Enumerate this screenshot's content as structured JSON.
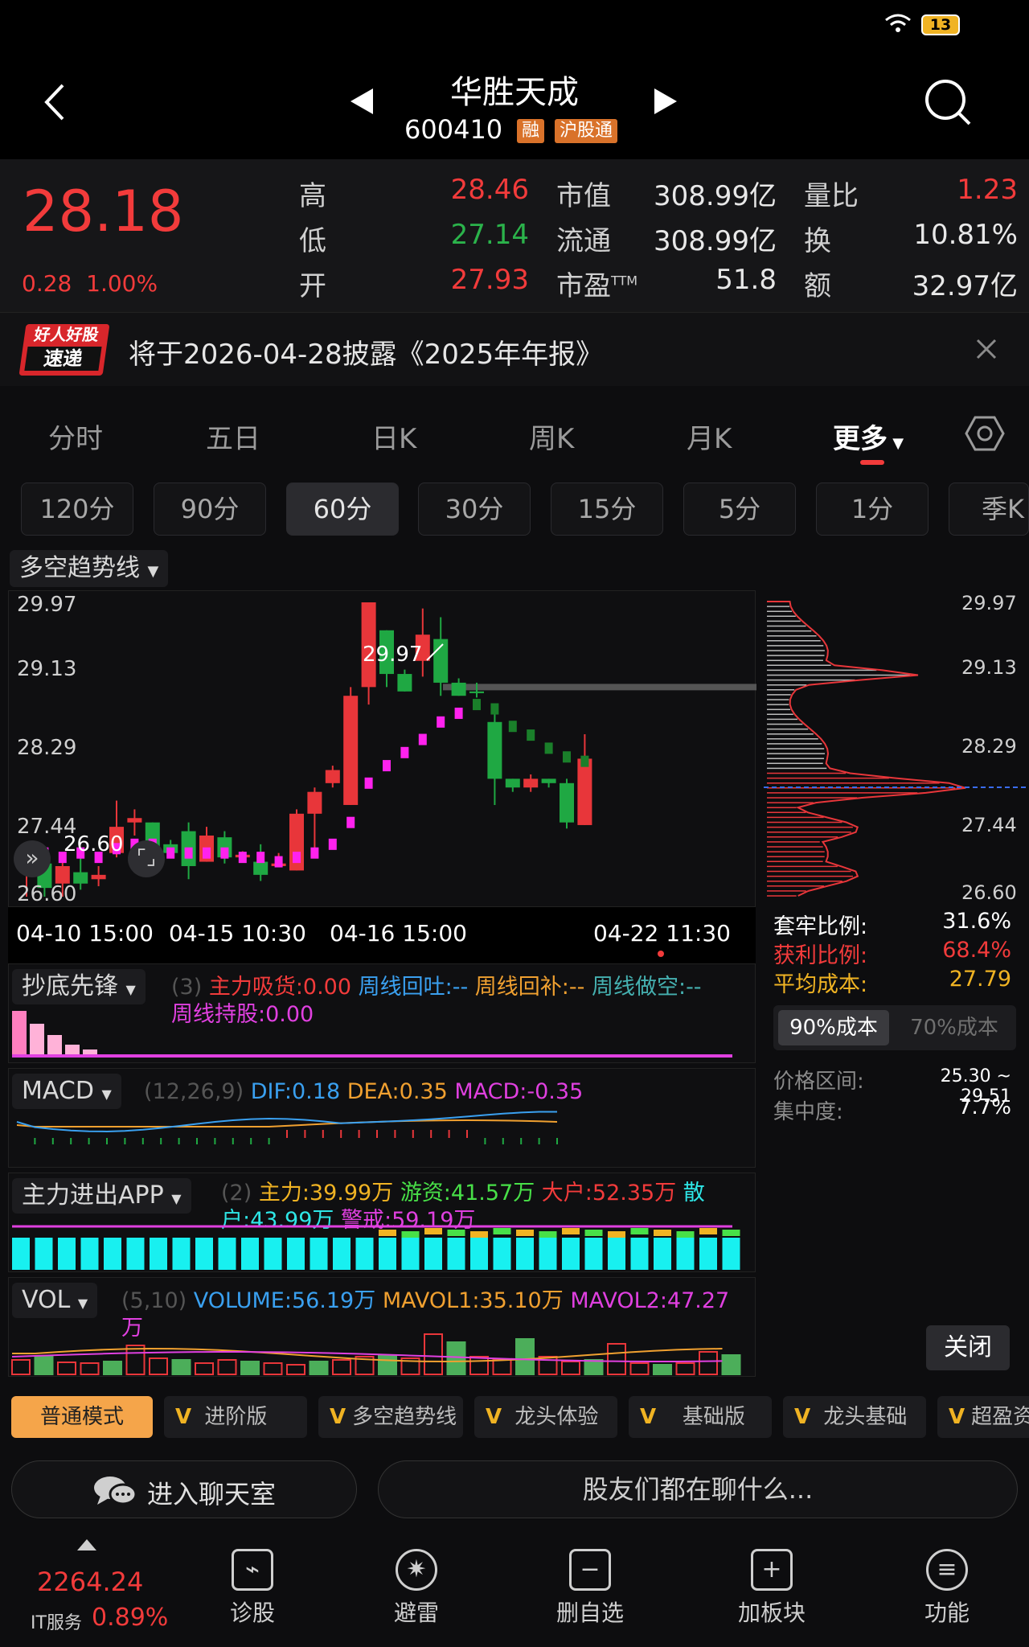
{
  "status": {
    "battery": "13"
  },
  "header": {
    "title": "华胜天成",
    "code": "600410",
    "tag1": "融",
    "tag2": "沪股通"
  },
  "quote": {
    "price": "28.18",
    "change": "0.28",
    "change_pct": "1.00%",
    "rows": [
      {
        "l1": "高",
        "v1": "28.46",
        "l2": "市值",
        "v2": "308.99亿",
        "l3": "量比",
        "v3": "1.23"
      },
      {
        "l1": "低",
        "v1": "27.14",
        "l2": "流通",
        "v2": "308.99亿",
        "l3": "换",
        "v3": "10.81%"
      },
      {
        "l1": "开",
        "v1": "27.93",
        "l2": "市盈",
        "l2sup": "TTM",
        "v2": "51.8",
        "l3": "额",
        "v3": "32.97亿"
      }
    ]
  },
  "notice": {
    "badge_top": "好人好股",
    "badge_bottom": "速递",
    "text": "将于2026-04-28披露《2025年年报》"
  },
  "tabs": [
    {
      "label": "分时"
    },
    {
      "label": "五日"
    },
    {
      "label": "日K"
    },
    {
      "label": "周K"
    },
    {
      "label": "月K"
    },
    {
      "label": "更多"
    }
  ],
  "ktypes": [
    {
      "label": "120分"
    },
    {
      "label": "90分"
    },
    {
      "label": "60分"
    },
    {
      "label": "30分"
    },
    {
      "label": "15分"
    },
    {
      "label": "5分"
    },
    {
      "label": "1分"
    },
    {
      "label": "季K"
    }
  ],
  "main_chart": {
    "indicator": "多空趋势线",
    "price_labels": [
      "29.97",
      "29.13",
      "28.29",
      "27.44",
      "26.60"
    ],
    "high_marker": "29.97",
    "low_marker": "26.60",
    "dates": [
      "04-10 15:00",
      "04-15 10:30",
      "04-16 15:00",
      "04-22 11:30"
    ]
  },
  "chart_data": {
    "type": "candlestick",
    "ylim": [
      26.6,
      29.97
    ],
    "candles": [
      [
        26.9,
        26.9,
        26.6,
        26.9
      ],
      [
        26.98,
        26.7,
        26.6,
        27.0
      ],
      [
        26.75,
        26.95,
        26.6,
        27.0
      ],
      [
        26.88,
        26.75,
        26.68,
        27.1
      ],
      [
        26.8,
        26.85,
        26.72,
        26.95
      ],
      [
        27.1,
        27.4,
        27.05,
        27.7
      ],
      [
        27.45,
        27.5,
        27.3,
        27.6
      ],
      [
        27.45,
        27.0,
        26.9,
        27.45
      ],
      [
        27.2,
        27.1,
        27.05,
        27.25
      ],
      [
        27.35,
        26.95,
        26.8,
        27.45
      ],
      [
        27.0,
        27.3,
        27.0,
        27.4
      ],
      [
        27.28,
        27.05,
        26.98,
        27.35
      ],
      [
        27.05,
        27.08,
        27.0,
        27.12
      ],
      [
        27.0,
        26.85,
        26.78,
        27.2
      ],
      [
        26.95,
        26.98,
        26.95,
        27.1
      ],
      [
        26.9,
        27.55,
        26.9,
        27.6
      ],
      [
        27.55,
        27.8,
        27.1,
        27.85
      ],
      [
        27.9,
        28.05,
        27.85,
        28.1
      ],
      [
        27.65,
        28.9,
        27.65,
        29.0
      ],
      [
        29.0,
        29.97,
        28.8,
        29.97
      ],
      [
        29.65,
        29.15,
        29.0,
        29.65
      ],
      [
        29.15,
        28.95,
        28.95,
        29.2
      ],
      [
        29.3,
        29.6,
        29.12,
        29.9
      ],
      [
        29.55,
        29.05,
        28.9,
        29.8
      ],
      [
        29.05,
        28.9,
        28.9,
        29.1
      ],
      [
        28.95,
        28.93,
        28.88,
        29.05
      ],
      [
        28.6,
        27.95,
        27.65,
        28.75
      ],
      [
        27.95,
        27.85,
        27.8,
        27.95
      ],
      [
        27.85,
        27.95,
        27.8,
        28.0
      ],
      [
        27.95,
        27.9,
        27.85,
        27.95
      ],
      [
        27.9,
        27.45,
        27.38,
        27.95
      ],
      [
        27.42,
        28.18,
        27.42,
        28.46
      ]
    ],
    "trend": [
      27.1,
      27.1,
      27.05,
      27.1,
      27.05,
      27.15,
      27.2,
      27.2,
      27.1,
      27.1,
      27.1,
      27.1,
      27.05,
      27.05,
      27.0,
      27.05,
      27.1,
      27.2,
      27.45,
      27.9,
      28.1,
      28.25,
      28.4,
      28.6,
      28.7,
      28.8,
      28.75,
      28.55,
      28.45,
      28.3,
      28.2,
      28.15
    ],
    "resistance": 29.0
  },
  "chip": {
    "labels": [
      "29.97",
      "29.13",
      "28.29",
      "27.44",
      "26.60"
    ],
    "rows": [
      {
        "label": "套牢比例:",
        "value": "31.6%"
      },
      {
        "label": "获利比例:",
        "value": "68.4%"
      },
      {
        "label": "平均成本:",
        "value": "27.79"
      }
    ],
    "btn1": "90%成本",
    "btn2": "70%成本",
    "range_label": "价格区间:",
    "range": "25.30 ~ 29.51",
    "conc_label": "集中度:",
    "conc": "7.7%",
    "close": "关闭"
  },
  "ind1": {
    "name": "抄底先锋",
    "param": "(3)",
    "items": [
      {
        "t": "主力吸货:0.00",
        "c": "#f23b3b"
      },
      {
        "t": "周线回吐:--",
        "c": "#3aa0f0"
      },
      {
        "t": "周线回补:--",
        "c": "#f0a030"
      },
      {
        "t": "周线做空:--",
        "c": "#45b0b0"
      },
      {
        "t": "周线持股:0.00",
        "c": "#e040e0"
      }
    ]
  },
  "ind2": {
    "name": "MACD",
    "param": "(12,26,9)",
    "items": [
      {
        "t": "DIF:0.18",
        "c": "#3aa0f0"
      },
      {
        "t": "DEA:0.35",
        "c": "#f0a030"
      },
      {
        "t": "MACD:-0.35",
        "c": "#e040e0"
      }
    ]
  },
  "ind3": {
    "name": "主力进出APP",
    "param": "(2)",
    "items": [
      {
        "t": "主力:39.99万",
        "c": "#f0b323"
      },
      {
        "t": "游资:41.57万",
        "c": "#48e048"
      },
      {
        "t": "大户:52.35万",
        "c": "#f23b3b"
      },
      {
        "t": "散户:43.99万",
        "c": "#2ee6e6"
      },
      {
        "t": "警戒:59.19万",
        "c": "#e040e0"
      }
    ]
  },
  "ind4": {
    "name": "VOL",
    "param": "(5,10)",
    "items": [
      {
        "t": "VOLUME:56.19万",
        "c": "#3aa0f0"
      },
      {
        "t": "MAVOL1:35.10万",
        "c": "#f0a030"
      },
      {
        "t": "MAVOL2:47.27万",
        "c": "#e040e0"
      }
    ]
  },
  "modes": [
    {
      "label": "普通模式"
    },
    {
      "label": "进阶版"
    },
    {
      "label": "多空趋势线"
    },
    {
      "label": "龙头体验"
    },
    {
      "label": "基础版"
    },
    {
      "label": "龙头基础"
    },
    {
      "label": "超盈资"
    }
  ],
  "chat": {
    "enter": "进入聊天室",
    "prompt": "股友们都在聊什么..."
  },
  "bottom": {
    "index_value": "2264.24",
    "index_name": "IT服务",
    "index_pct": "0.89%",
    "nav": [
      {
        "label": "诊股"
      },
      {
        "label": "避雷"
      },
      {
        "label": "删自选"
      },
      {
        "label": "加板块"
      },
      {
        "label": "功能"
      }
    ]
  }
}
